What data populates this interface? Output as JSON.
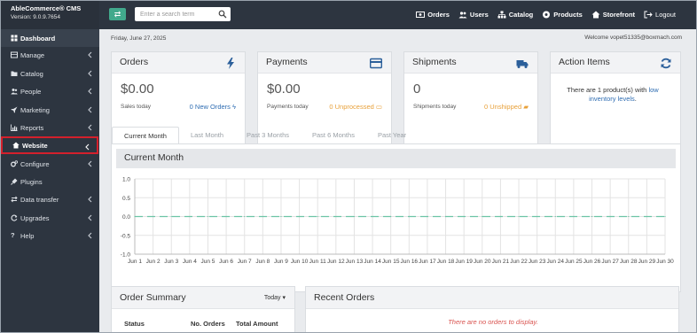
{
  "brand": {
    "name": "AbleCommerce® CMS",
    "version": "Version: 9.0.9.7654"
  },
  "search": {
    "placeholder": "Enter a search term"
  },
  "topnav": {
    "orders": "Orders",
    "users": "Users",
    "catalog": "Catalog",
    "products": "Products",
    "storefront": "Storefront",
    "logout": "Logout"
  },
  "sidebar": {
    "items": [
      {
        "label": "Dashboard",
        "icon": "dashboard-icon"
      },
      {
        "label": "Manage",
        "icon": "grid-icon"
      },
      {
        "label": "Catalog",
        "icon": "folder-icon"
      },
      {
        "label": "People",
        "icon": "users-icon"
      },
      {
        "label": "Marketing",
        "icon": "rocket-icon"
      },
      {
        "label": "Reports",
        "icon": "bar-chart-icon"
      },
      {
        "label": "Website",
        "icon": "home-icon"
      },
      {
        "label": "Configure",
        "icon": "gears-icon"
      },
      {
        "label": "Plugins",
        "icon": "plug-icon"
      },
      {
        "label": "Data transfer",
        "icon": "exchange-icon"
      },
      {
        "label": "Upgrades",
        "icon": "refresh-icon"
      },
      {
        "label": "Help",
        "icon": "question-icon"
      }
    ]
  },
  "header": {
    "date": "Friday, June 27, 2025",
    "welcome": "Welcome vopet51335@boxmach.com"
  },
  "cards": {
    "orders": {
      "title": "Orders",
      "value": "$0.00",
      "sub": "Sales today",
      "stat": "0 New Orders"
    },
    "payments": {
      "title": "Payments",
      "value": "$0.00",
      "sub": "Payments today",
      "stat": "0 Unprocessed"
    },
    "shipments": {
      "title": "Shipments",
      "value": "0",
      "sub": "Shipments today",
      "stat": "0 Unshipped"
    },
    "action": {
      "title": "Action Items",
      "text_prefix": "There are 1 product(s) with",
      "link": "low inventory levels",
      "text_suffix": "."
    }
  },
  "tabs": [
    "Current Month",
    "Last Month",
    "Past 3 Months",
    "Past 6 Months",
    "Past Year"
  ],
  "chart_title": "Current Month",
  "chart_data": {
    "type": "line",
    "x": [
      "Jun 1",
      "Jun 2",
      "Jun 3",
      "Jun 4",
      "Jun 5",
      "Jun 6",
      "Jun 7",
      "Jun 8",
      "Jun 9",
      "Jun 10",
      "Jun 11",
      "Jun 12",
      "Jun 13",
      "Jun 14",
      "Jun 15",
      "Jun 16",
      "Jun 17",
      "Jun 18",
      "Jun 19",
      "Jun 20",
      "Jun 21",
      "Jun 22",
      "Jun 23",
      "Jun 24",
      "Jun 25",
      "Jun 26",
      "Jun 27",
      "Jun 28",
      "Jun 29",
      "Jun 30"
    ],
    "series": [
      {
        "values": [
          0,
          0,
          0,
          0,
          0,
          0,
          0,
          0,
          0,
          0,
          0,
          0,
          0,
          0,
          0,
          0,
          0,
          0,
          0,
          0,
          0,
          0,
          0,
          0,
          0,
          0,
          0,
          0,
          0,
          0
        ]
      }
    ],
    "yticks": [
      "1.0",
      "0.5",
      "0.0",
      "-0.5",
      "-1.0"
    ],
    "ylim": [
      -1.0,
      1.0
    ],
    "grid": true,
    "line_color": "#6cc4a6"
  },
  "order_summary": {
    "title": "Order Summary",
    "range": "Today",
    "columns": [
      "Status",
      "No. Orders",
      "Total Amount"
    ]
  },
  "recent_orders": {
    "title": "Recent Orders",
    "empty": "There are no orders to display."
  },
  "colors": {
    "accent": "#41a98c",
    "link": "#2f6db2",
    "warning": "#e8a13a",
    "highlight": "#d4202c",
    "sidebar_bg": "#2d3540"
  }
}
